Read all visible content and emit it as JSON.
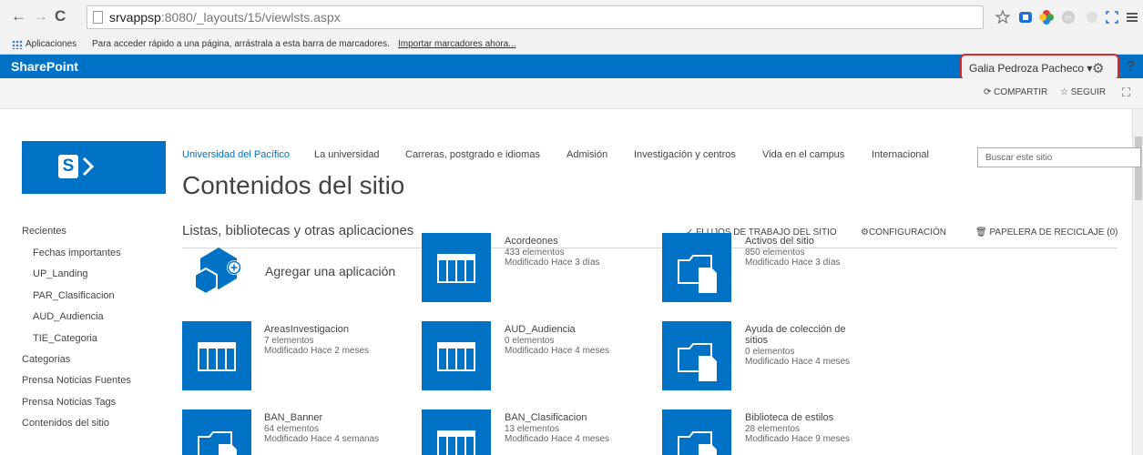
{
  "browser": {
    "url_host": "srvappsp",
    "url_rest": ":8080/_layouts/15/viewlsts.aspx",
    "bookmarks": {
      "apps": "Aplicaciones",
      "hint": "Para acceder rápido a una página, arrástrala a esta barra de marcadores.",
      "import": "Importar marcadores ahora..."
    }
  },
  "suitebar": {
    "brand": "SharePoint",
    "user": "Galia Pedroza Pacheco ▾",
    "help": "?"
  },
  "ribbon": {
    "share": "COMPARTIR",
    "follow": "SEGUIR"
  },
  "topnav": {
    "items": [
      "Universidad del Pacífico",
      "La universidad",
      "Carreras, postgrado e idiomas",
      "Admisión",
      "Investigación y centros",
      "Vida en el campus",
      "Internacional"
    ],
    "search_placeholder": "Buscar este sitio"
  },
  "page_title": "Contenidos del sitio",
  "leftnav": {
    "items": [
      "Recientes",
      "Fechas importantes",
      "UP_Landing",
      "PAR_Clasificacion",
      "AUD_Audiencia",
      "TIE_Categoria",
      "Categorias",
      "Prensa Noticias Fuentes",
      "Prensa Noticias Tags",
      "Contenidos del sitio"
    ]
  },
  "section": {
    "title": "Listas, bibliotecas y otras aplicaciones",
    "workflows": "FLUJOS DE TRABAJO DEL SITIO",
    "settings": "CONFIGURACIÓN",
    "recycle": "PAPELERA DE RECICLAJE (0)"
  },
  "add_app": "Agregar una aplicación",
  "tiles": [
    {
      "name": "Acordeones",
      "count": "433 elementos",
      "modified": "Modificado Hace 3 días",
      "icon": "list-icon"
    },
    {
      "name": "Activos del sitio",
      "count": "850 elementos",
      "modified": "Modificado Hace 3 días",
      "icon": "library-icon"
    },
    {
      "name": "AreasInvestigacion",
      "count": "7 elementos",
      "modified": "Modificado Hace 2 meses",
      "icon": "list-icon"
    },
    {
      "name": "AUD_Audiencia",
      "count": "0 elementos",
      "modified": "Modificado Hace 4 meses",
      "icon": "list-icon"
    },
    {
      "name": "Ayuda de colección de sitios",
      "count": "0 elementos",
      "modified": "Modificado Hace 4 meses",
      "icon": "library-icon"
    },
    {
      "name": "BAN_Banner",
      "count": "64 elementos",
      "modified": "Modificado Hace 4 semanas",
      "icon": "library-icon"
    },
    {
      "name": "BAN_Clasificacion",
      "count": "13 elementos",
      "modified": "Modificado Hace 4 meses",
      "icon": "list-icon"
    },
    {
      "name": "Biblioteca de estilos",
      "count": "28 elementos",
      "modified": "Modificado Hace 9 meses",
      "icon": "library-icon"
    }
  ],
  "colors": {
    "accent": "#0072c6",
    "highlight": "#d9262c"
  }
}
